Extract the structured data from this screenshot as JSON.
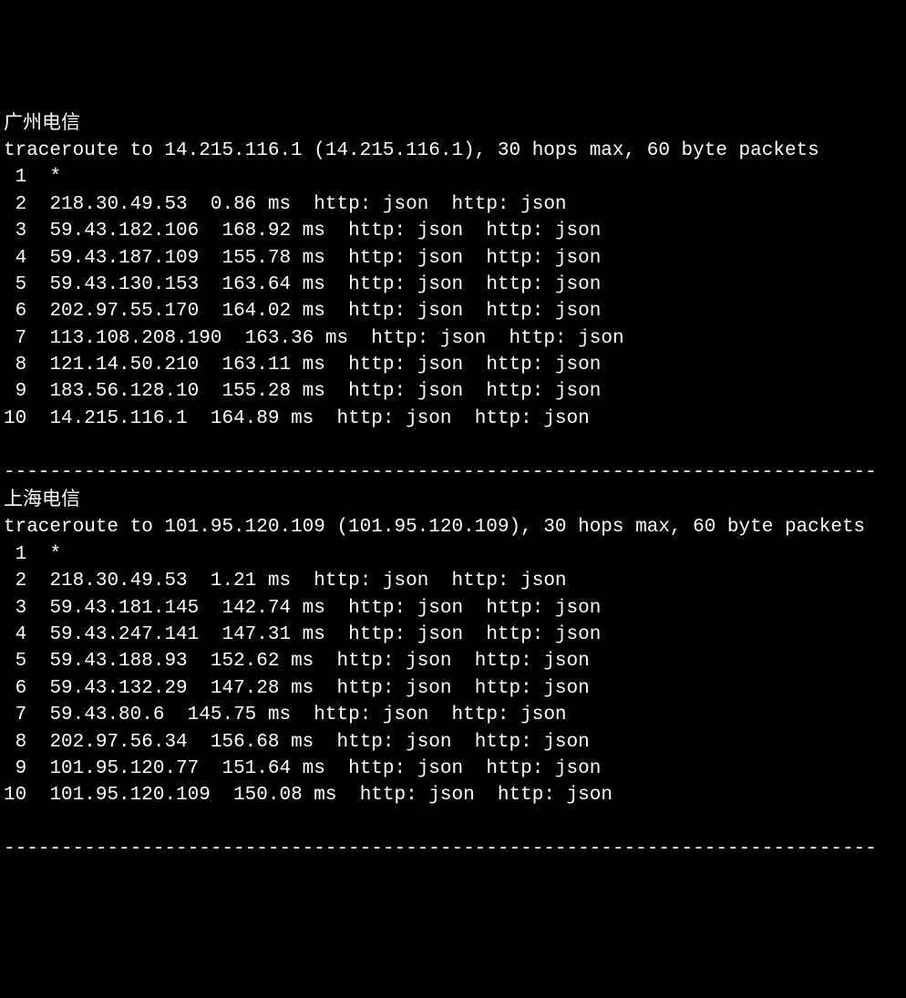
{
  "sections": [
    {
      "title": "广州电信",
      "header": "traceroute to 14.215.116.1 (14.215.116.1), 30 hops max, 60 byte packets",
      "hops": [
        {
          "num": " 1",
          "text": "*"
        },
        {
          "num": " 2",
          "text": "218.30.49.53  0.86 ms  http: json  http: json"
        },
        {
          "num": " 3",
          "text": "59.43.182.106  168.92 ms  http: json  http: json"
        },
        {
          "num": " 4",
          "text": "59.43.187.109  155.78 ms  http: json  http: json"
        },
        {
          "num": " 5",
          "text": "59.43.130.153  163.64 ms  http: json  http: json"
        },
        {
          "num": " 6",
          "text": "202.97.55.170  164.02 ms  http: json  http: json"
        },
        {
          "num": " 7",
          "text": "113.108.208.190  163.36 ms  http: json  http: json"
        },
        {
          "num": " 8",
          "text": "121.14.50.210  163.11 ms  http: json  http: json"
        },
        {
          "num": " 9",
          "text": "183.56.128.10  155.28 ms  http: json  http: json"
        },
        {
          "num": "10",
          "text": "14.215.116.1  164.89 ms  http: json  http: json"
        }
      ]
    },
    {
      "title": "上海电信",
      "header": "traceroute to 101.95.120.109 (101.95.120.109), 30 hops max, 60 byte packets",
      "hops": [
        {
          "num": " 1",
          "text": "*"
        },
        {
          "num": " 2",
          "text": "218.30.49.53  1.21 ms  http: json  http: json"
        },
        {
          "num": " 3",
          "text": "59.43.181.145  142.74 ms  http: json  http: json"
        },
        {
          "num": " 4",
          "text": "59.43.247.141  147.31 ms  http: json  http: json"
        },
        {
          "num": " 5",
          "text": "59.43.188.93  152.62 ms  http: json  http: json"
        },
        {
          "num": " 6",
          "text": "59.43.132.29  147.28 ms  http: json  http: json"
        },
        {
          "num": " 7",
          "text": "59.43.80.6  145.75 ms  http: json  http: json"
        },
        {
          "num": " 8",
          "text": "202.97.56.34  156.68 ms  http: json  http: json"
        },
        {
          "num": " 9",
          "text": "101.95.120.77  151.64 ms  http: json  http: json"
        },
        {
          "num": "10",
          "text": "101.95.120.109  150.08 ms  http: json  http: json"
        }
      ]
    }
  ],
  "separator": "----------------------------------------------------------------------------"
}
